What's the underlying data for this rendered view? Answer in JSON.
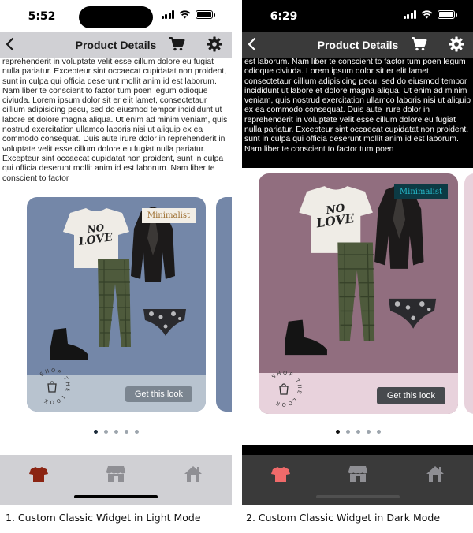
{
  "screens": [
    {
      "id": "light",
      "time": "5:52",
      "nav_title": "Product Details",
      "description": "reprehenderit in voluptate velit esse cillum dolore eu fugiat nulla pariatur. Excepteur sint occaecat cupidatat non proident, sunt in culpa qui officia deserunt mollit anim id est laborum. Nam liber te conscient to factor tum poen legum odioque civiuda. Lorem ipsum dolor sit er elit lamet, consectetaur cillium adipisicing pecu, sed do eiusmod tempor incididunt ut labore et dolore magna aliqua. Ut enim ad minim veniam, quis nostrud exercitation ullamco laboris nisi ut aliquip ex ea commodo consequat. Duis aute irure dolor in reprehenderit in voluptate velit esse cillum dolore eu fugiat nulla pariatur. Excepteur sint occaecat cupidatat non proident, sunt in culpa qui officia deserunt mollit anim id est laborum. Nam liber te conscient to factor",
      "tag": "Minimalist",
      "cta": "Get this look",
      "shop_the_look": "SHOP THE LOOK",
      "pager_active": 0,
      "pager_count": 5
    },
    {
      "id": "dark",
      "time": "6:29",
      "nav_title": "Product Details",
      "description": "est laborum. Nam liber te conscient to factor tum poen legum odioque civiuda. Lorem ipsum dolor sit er elit lamet, consectetaur cillium adipisicing pecu, sed do eiusmod tempor incididunt ut labore et dolore magna aliqua. Ut enim ad minim veniam, quis nostrud exercitation ullamco laboris nisi ut aliquip ex ea commodo consequat. Duis aute irure dolor in reprehenderit in voluptate velit esse cillum dolore eu fugiat nulla pariatur. Excepteur sint occaecat cupidatat non proident, sunt in culpa qui officia deserunt mollit anim id est laborum. Nam liber te conscient to factor tum poen",
      "tag": "Minimalist",
      "cta": "Get this look",
      "shop_the_look": "SHOP THE LOOK",
      "pager_active": 0,
      "pager_count": 5
    }
  ],
  "captions": {
    "light": "1. Custom Classic Widget in Light Mode",
    "dark": "2. Custom Classic Widget in Dark Mode"
  },
  "icons": {
    "nav": [
      "back-chevron-icon",
      "cart-icon",
      "gear-icon"
    ],
    "tabs": [
      "tshirt-icon",
      "store-icon",
      "home-icon"
    ]
  },
  "colors": {
    "light_card": "#7487a8",
    "dark_card": "#916e7f",
    "tab_active_light": "#8b2412",
    "tab_active_dark": "#f06a6a",
    "tab_inactive": "#8f8f94"
  }
}
